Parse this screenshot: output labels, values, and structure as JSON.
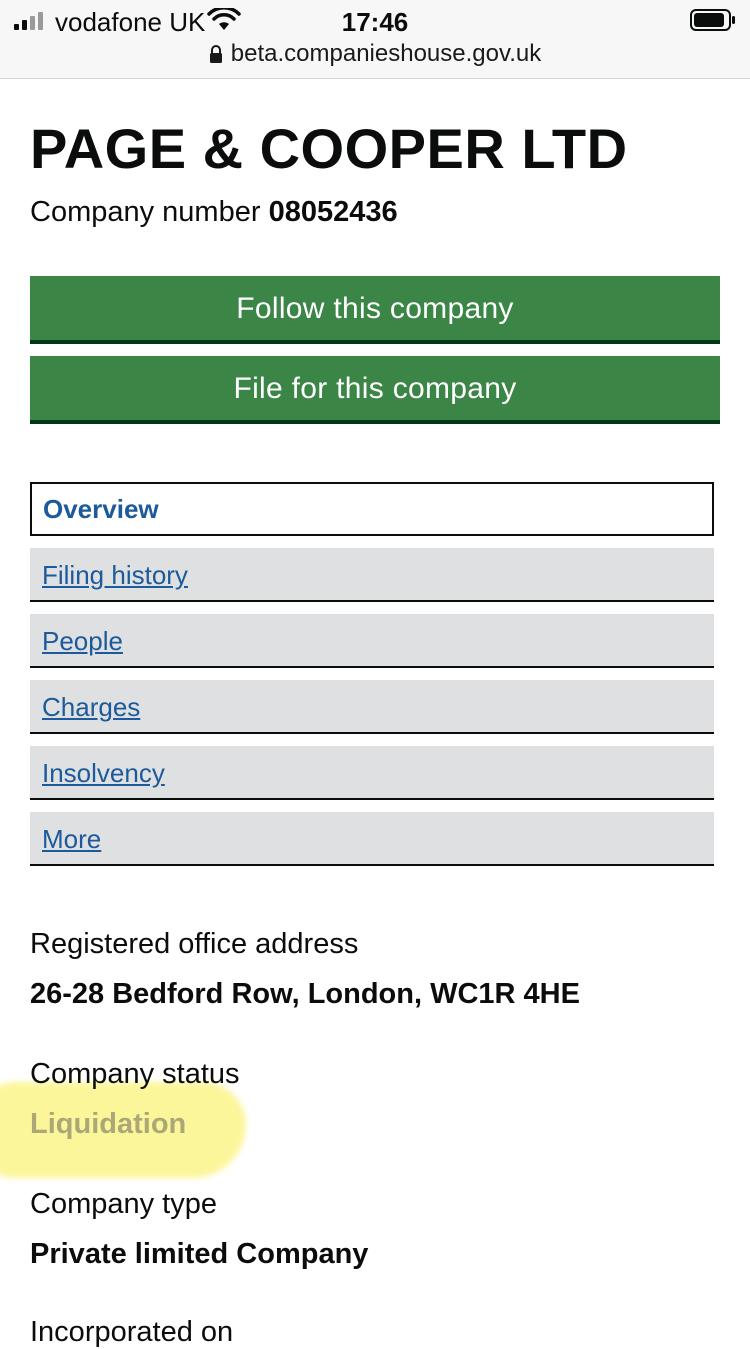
{
  "status_bar": {
    "carrier": "vodafone UK",
    "time": "17:46",
    "url": "beta.companieshouse.gov.uk",
    "icons": [
      "signal-icon",
      "wifi-icon",
      "battery-icon",
      "lock-icon"
    ]
  },
  "company": {
    "name": "PAGE & COOPER LTD",
    "number_label": "Company number",
    "number": "08052436"
  },
  "actions": {
    "follow_label": "Follow this company",
    "file_label": "File for this company",
    "button_color": "#3b8547"
  },
  "tabs": [
    {
      "label": "Overview",
      "active": true
    },
    {
      "label": "Filing history",
      "active": false
    },
    {
      "label": "People",
      "active": false
    },
    {
      "label": "Charges",
      "active": false
    },
    {
      "label": "Insolvency",
      "active": false
    },
    {
      "label": "More",
      "active": false
    }
  ],
  "details": {
    "address_label": "Registered office address",
    "address_value": "26-28 Bedford Row, London, WC1R 4HE",
    "status_label": "Company status",
    "status_value": "Liquidation",
    "type_label": "Company type",
    "type_value": "Private limited Company",
    "incorporated_label": "Incorporated on"
  },
  "colors": {
    "link": "#1d5a9b",
    "highlight": "#fbf37a"
  }
}
